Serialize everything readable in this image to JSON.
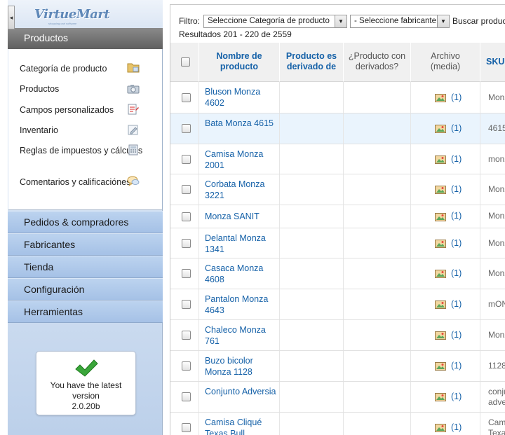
{
  "sidebar": {
    "logo_text": "VirtueMart",
    "logo_tagline": "shopping cart software",
    "products_header": "Productos",
    "submenu": [
      {
        "label": "Categoría de producto",
        "icon": "folder-icon"
      },
      {
        "label": "Productos",
        "icon": "camera-icon"
      },
      {
        "label": "Campos personalizados",
        "icon": "document-edit-icon"
      },
      {
        "label": "Inventario",
        "icon": "edit-form-icon"
      },
      {
        "label": "Reglas de impuestos y cálculos",
        "icon": "calculator-icon"
      },
      {
        "label": "Comentarios y calificaciónes",
        "icon": "speech-bubble-icon"
      }
    ],
    "nav": [
      {
        "label": "Pedidos & compradores"
      },
      {
        "label": "Fabricantes"
      },
      {
        "label": "Tienda"
      },
      {
        "label": "Configuración"
      },
      {
        "label": "Herramientas"
      }
    ],
    "version": {
      "message": "You have the latest version",
      "number": "2.0.20b"
    }
  },
  "filter": {
    "label": "Filtro:",
    "category_select": "Seleccione Categoría de producto",
    "manufacturer_select": "- Seleccione fabricante -",
    "search_label": "Buscar producto"
  },
  "results_text": "Resultados 201 - 220 de 2559",
  "table": {
    "headers": {
      "name": "Nombre de producto",
      "derived_from": "Producto es derivado de",
      "has_derived": "¿Producto con derivados?",
      "media": "Archivo (media)",
      "sku": "SKU de producto"
    },
    "rows": [
      {
        "name": "Bluson Monza 4602",
        "media": "(1)",
        "sku": "Monza"
      },
      {
        "name": "Bata Monza 4615",
        "media": "(1)",
        "sku": "4615"
      },
      {
        "name": "Camisa Monza 2001",
        "media": "(1)",
        "sku": "monza"
      },
      {
        "name": "Corbata Monza 3221",
        "media": "(1)",
        "sku": "Monza"
      },
      {
        "name": "Monza SANIT",
        "media": "(1)",
        "sku": "Monza"
      },
      {
        "name": "Delantal Monza 1341",
        "media": "(1)",
        "sku": "Monza"
      },
      {
        "name": "Casaca Monza 4608",
        "media": "(1)",
        "sku": "Monza"
      },
      {
        "name": "Pantalon Monza 4643",
        "media": "(1)",
        "sku": "mONZ"
      },
      {
        "name": "Chaleco Monza 761",
        "media": "(1)",
        "sku": "Monza"
      },
      {
        "name": "Buzo bicolor Monza 1128",
        "media": "(1)",
        "sku": "1128"
      },
      {
        "name": "Conjunto Adversia",
        "media": "(1)",
        "sku": "conju adve"
      },
      {
        "name": "Camisa Cliqué Texas Bull",
        "media": "(1)",
        "sku": "Cami Texa"
      }
    ]
  },
  "colors": {
    "link": "#1561a8",
    "sidebar_nav": "#a5c1e6",
    "header_bg": "#f0f0f0",
    "highlight_row": "#eaf4fd"
  }
}
